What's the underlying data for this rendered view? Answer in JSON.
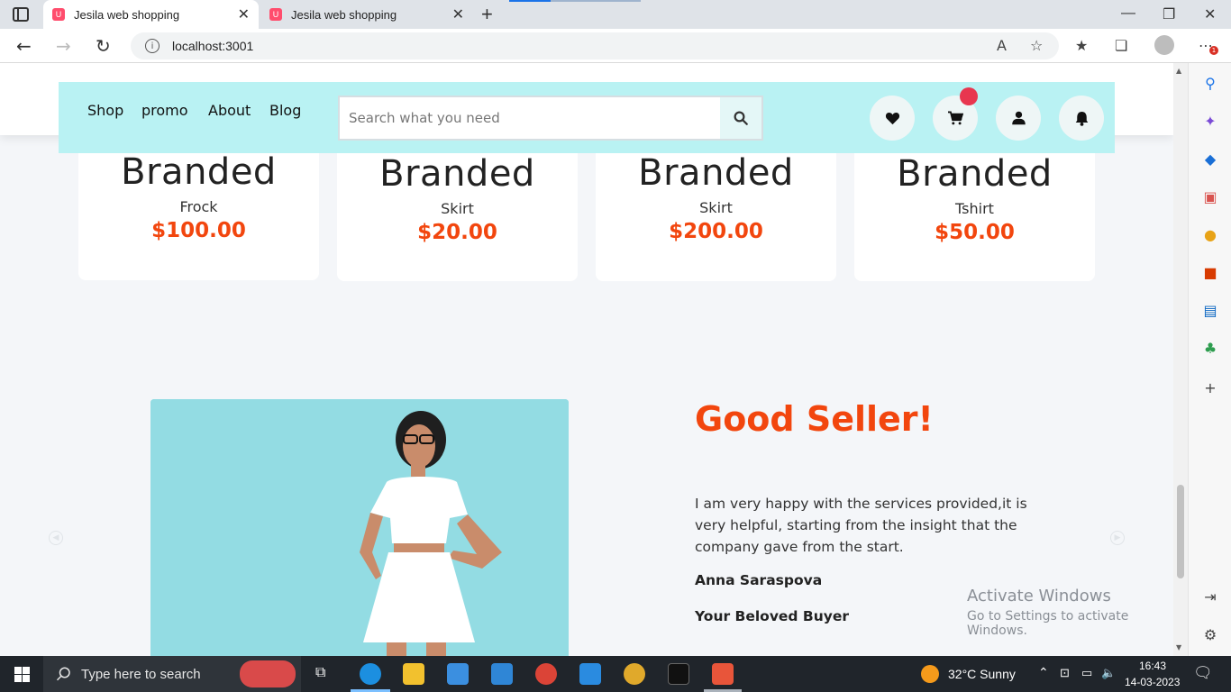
{
  "browser": {
    "tabs": [
      {
        "title": "Jesila web shopping",
        "active": true
      },
      {
        "title": "Jesila web shopping",
        "active": false
      }
    ],
    "new_tab_symbol": "+",
    "url": "localhost:3001",
    "extension_badge": "1"
  },
  "site": {
    "nav": {
      "links": [
        "Shop",
        "promo",
        "About",
        "Blog"
      ],
      "search_placeholder": "Search what you need",
      "icons": [
        "heart-icon",
        "cart-icon",
        "user-icon",
        "bell-icon"
      ]
    },
    "products": [
      {
        "brand": "Branded",
        "name": "Frock",
        "price": "$100.00"
      },
      {
        "brand": "Branded",
        "name": "Skirt",
        "price": "$20.00"
      },
      {
        "brand": "Branded",
        "name": "Skirt",
        "price": "$200.00"
      },
      {
        "brand": "Branded",
        "name": "Tshirt",
        "price": "$50.00"
      }
    ],
    "testimonial": {
      "title": "Good Seller!",
      "text": "I am very happy with the services provided,it is very helpful, starting from the insight that the company gave from the start.",
      "name": "Anna Saraspova",
      "role": "Your Beloved Buyer"
    },
    "colors": {
      "accent": "#f2460e",
      "navbar_bg": "#b9f2f3",
      "badge": "#e8364f",
      "image_bg": "#93dce3"
    }
  },
  "watermark": {
    "line1": "Activate Windows",
    "line2": "Go to Settings to activate Windows."
  },
  "taskbar": {
    "search_placeholder": "Type here to search",
    "weather": "32°C  Sunny",
    "time": "16:43",
    "date": "14-03-2023"
  }
}
